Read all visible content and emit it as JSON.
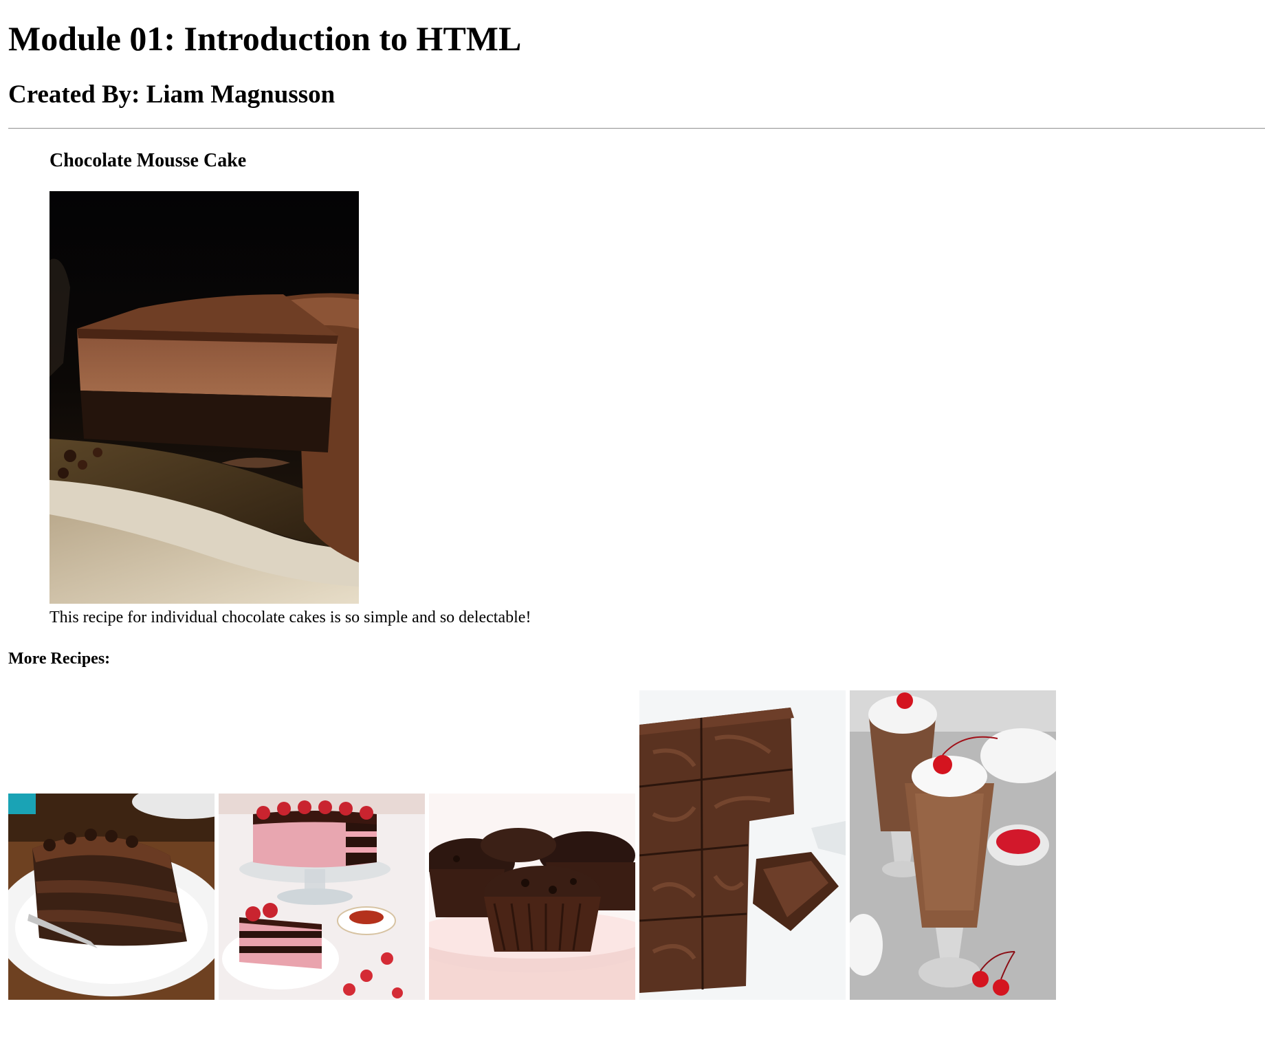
{
  "header": {
    "title": "Module 01: Introduction to HTML",
    "author": "Created By: Liam Magnusson"
  },
  "featured": {
    "heading": "Chocolate Mousse Cake",
    "image_name": "chocolate-mousse-cake-photo",
    "caption": "This recipe for individual chocolate cakes is so simple and so delectable!"
  },
  "more_recipes": {
    "heading": "More Recipes:",
    "items": [
      {
        "image_name": "chocolate-layer-cake-slice-photo"
      },
      {
        "image_name": "strawberry-chocolate-cake-photo"
      },
      {
        "image_name": "chocolate-muffins-photo"
      },
      {
        "image_name": "brownies-photo"
      },
      {
        "image_name": "chocolate-milkshake-photo"
      }
    ]
  },
  "colors": {
    "text": "#000000",
    "background": "#ffffff",
    "divider": "#9a9a9a"
  }
}
